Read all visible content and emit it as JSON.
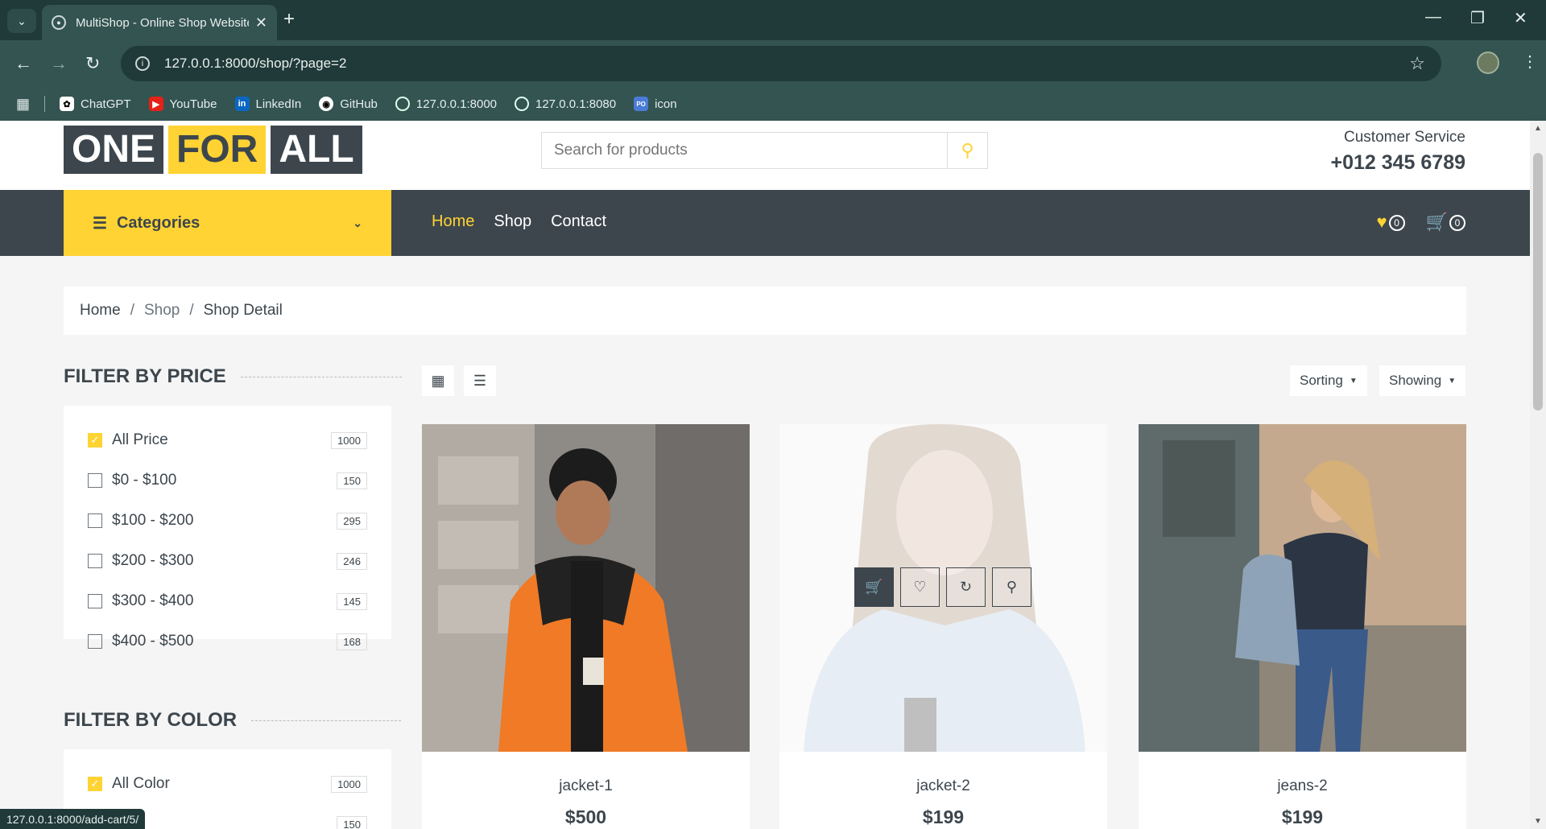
{
  "browser": {
    "tab_title": "MultiShop - Online Shop Website",
    "address": "127.0.0.1:8000/shop/?page=2",
    "bookmarks": [
      {
        "label": "ChatGPT",
        "icon": "chatgpt-icon"
      },
      {
        "label": "YouTube",
        "icon": "youtube-icon"
      },
      {
        "label": "LinkedIn",
        "icon": "linkedin-icon"
      },
      {
        "label": "GitHub",
        "icon": "github-icon"
      },
      {
        "label": "127.0.0.1:8000",
        "icon": "globe-icon"
      },
      {
        "label": "127.0.0.1:8080",
        "icon": "globe-icon"
      },
      {
        "label": "icon",
        "icon": "bookmark-icon"
      }
    ],
    "status_url": "127.0.0.1:8000/add-cart/5/"
  },
  "header": {
    "logo": [
      "ONE",
      "FOR",
      "ALL"
    ],
    "search_placeholder": "Search for products",
    "cs_label": "Customer Service",
    "cs_phone": "+012 345 6789"
  },
  "nav": {
    "categories": "Categories",
    "links": [
      "Home",
      "Shop",
      "Contact"
    ],
    "wishlist_count": "0",
    "cart_count": "0"
  },
  "breadcrumb": [
    "Home",
    "Shop",
    "Shop Detail"
  ],
  "filters": {
    "price_title": "FILTER BY PRICE",
    "price": [
      {
        "label": "All Price",
        "count": "1000",
        "checked": true
      },
      {
        "label": "$0 - $100",
        "count": "150"
      },
      {
        "label": "$100 - $200",
        "count": "295"
      },
      {
        "label": "$200 - $300",
        "count": "246"
      },
      {
        "label": "$300 - $400",
        "count": "145"
      },
      {
        "label": "$400 - $500",
        "count": "168"
      }
    ],
    "color_title": "FILTER BY COLOR",
    "color": [
      {
        "label": "All Color",
        "count": "1000",
        "checked": true
      },
      {
        "label": "",
        "count": "150"
      }
    ]
  },
  "toolbar": {
    "sorting": "Sorting",
    "showing": "Showing"
  },
  "products": [
    {
      "name": "jacket-1",
      "price": "$500"
    },
    {
      "name": "jacket-2",
      "price": "$199"
    },
    {
      "name": "jeans-2",
      "price": "$199"
    }
  ],
  "colors": {
    "accent": "#FFD333",
    "dark": "#3D464D"
  }
}
